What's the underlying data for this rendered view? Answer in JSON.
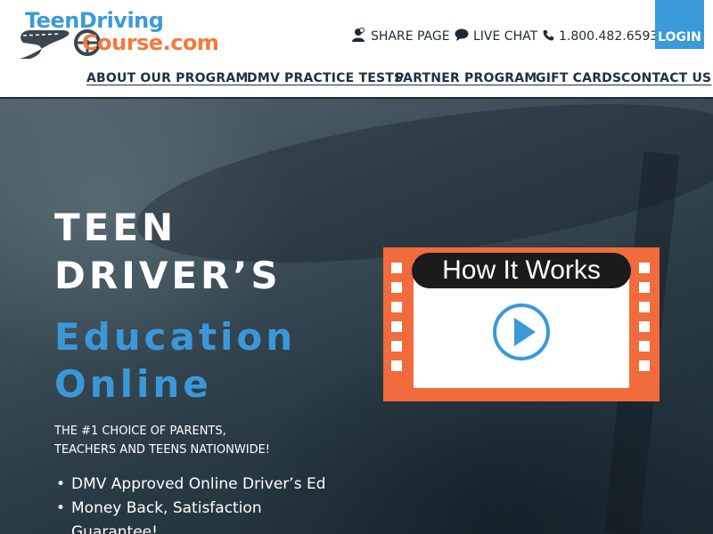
{
  "header": {
    "logo": {
      "line1": "TeenDriving",
      "line2": "Course.com"
    },
    "utility": {
      "share": "SHARE PAGE",
      "chat": "LIVE CHAT",
      "phone": "1.800.482.6593"
    },
    "login_label": "LOGIN",
    "nav": [
      {
        "label": "ABOUT OUR PROGRAM"
      },
      {
        "label": "DMV PRACTICE TESTS"
      },
      {
        "label": "PARTNER PROGRAM"
      },
      {
        "label": "GIFT CARDS"
      },
      {
        "label": "CONTACT US"
      }
    ]
  },
  "hero": {
    "title_line1": "TEEN",
    "title_line2": "DRIVER’S",
    "subtitle_line1": "Education",
    "subtitle_line2": "Online",
    "tagline_line1": "THE #1 CHOICE OF PARENTS,",
    "tagline_line2": "TEACHERS AND TEENS NATIONWIDE!",
    "bullets": [
      "DMV Approved Online Driver’s Ed",
      "Money Back, Satisfaction Guarantee!"
    ]
  },
  "video": {
    "label": "How It Works"
  },
  "colors": {
    "brand_blue": "#3a9ad9",
    "brand_orange": "#f26b3c",
    "nav_text": "#1d3147"
  },
  "icons": [
    "share-user-icon",
    "chat-bubble-icon",
    "phone-icon",
    "play-icon",
    "steering-wheel-icon"
  ]
}
